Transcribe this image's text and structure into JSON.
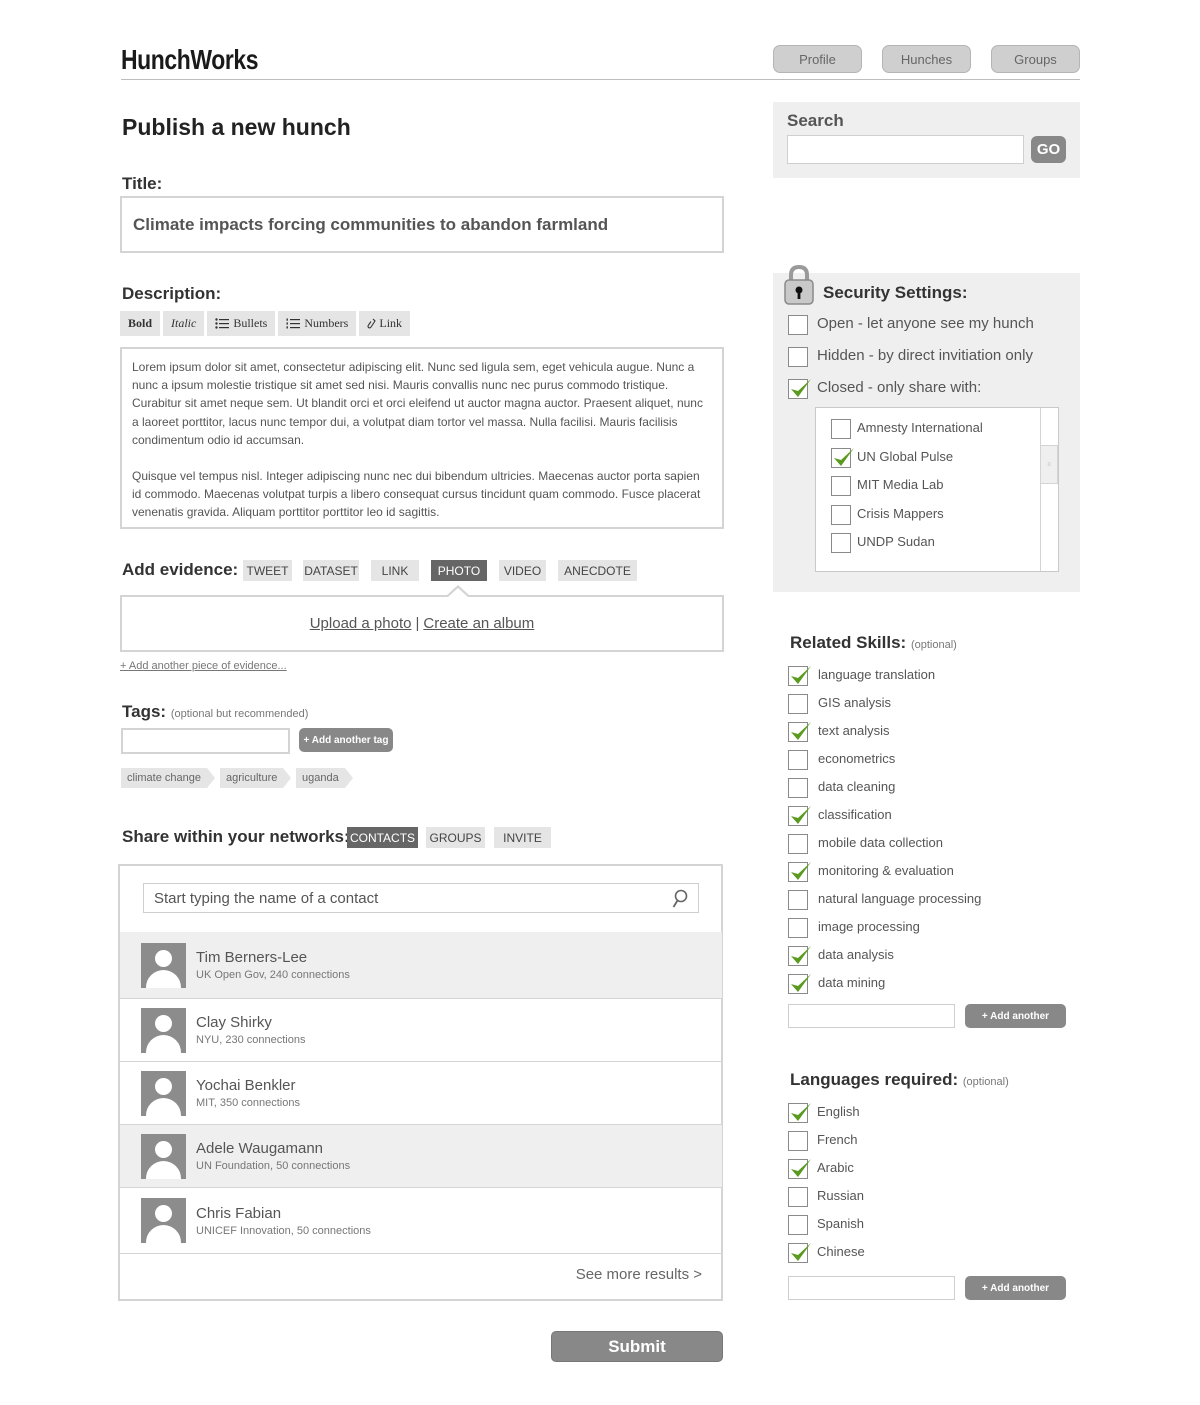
{
  "app": {
    "logo": "HunchWorks"
  },
  "nav": {
    "profile": "Profile",
    "hunches": "Hunches",
    "groups": "Groups"
  },
  "page_title": "Publish a new hunch",
  "title_section": {
    "label": "Title:",
    "value": "Climate impacts forcing communities to abandon farmland"
  },
  "description": {
    "label": "Description:",
    "toolbar": {
      "bold": "Bold",
      "italic": "Italic",
      "bullets": "Bullets",
      "numbers": "Numbers",
      "link": "Link"
    },
    "paragraph1": "Lorem ipsum dolor sit amet, consectetur adipiscing elit. Nunc sed ligula sem, eget vehicula augue. Nunc a nunc a ipsum molestie tristique sit amet sed nisi. Mauris convallis nunc nec purus commodo tristique. Curabitur sit amet neque sem. Ut blandit orci et orci eleifend ut auctor magna auctor. Praesent aliquet, nunc a laoreet porttitor, lacus nunc tempor dui, a volutpat diam tortor vel massa. Nulla facilisi. Mauris facilisis condimentum odio id accumsan.",
    "paragraph2": "Quisque vel tempus nisl. Integer adipiscing nunc nec dui bibendum ultricies. Maecenas auctor porta sapien id commodo. Maecenas volutpat turpis a libero consequat cursus tincidunt quam commodo. Fusce placerat venenatis gravida. Aliquam porttitor porttitor leo id sagittis."
  },
  "evidence": {
    "label": "Add evidence:",
    "tabs": [
      "TWEET",
      "DATASET",
      "LINK",
      "PHOTO",
      "VIDEO",
      "ANECDOTE"
    ],
    "active_tab": "PHOTO",
    "upload_link": "Upload a photo",
    "separator": "|",
    "album_link": "Create an album",
    "add_another": "+ Add another piece of evidence..."
  },
  "tags": {
    "label": "Tags:",
    "optional": "(optional but recommended)",
    "input_value": "",
    "add_button": "+ Add another tag",
    "items": [
      "climate change",
      "agriculture",
      "uganda"
    ]
  },
  "share": {
    "label": "Share within your networks:",
    "tabs": [
      "CONTACTS",
      "GROUPS",
      "INVITE"
    ],
    "active_tab": "CONTACTS",
    "search_placeholder": "Start typing the name of a contact",
    "contacts": [
      {
        "name": "Tim Berners-Lee",
        "detail": "UK Open Gov, 240 connections"
      },
      {
        "name": "Clay Shirky",
        "detail": "NYU, 230 connections"
      },
      {
        "name": "Yochai Benkler",
        "detail": "MIT, 350 connections"
      },
      {
        "name": "Adele Waugamann",
        "detail": "UN Foundation, 50 connections"
      },
      {
        "name": "Chris Fabian",
        "detail": "UNICEF Innovation, 50 connections"
      }
    ],
    "see_more": "See more results >"
  },
  "submit": "Submit",
  "search": {
    "label": "Search",
    "value": "",
    "go": "GO"
  },
  "security": {
    "title": "Security Settings:",
    "options": [
      {
        "label": "Open - let anyone see my hunch",
        "checked": false
      },
      {
        "label": "Hidden - by direct invitiation only",
        "checked": false
      },
      {
        "label": "Closed - only share with:",
        "checked": true
      }
    ],
    "orgs": [
      {
        "label": "Amnesty International",
        "checked": false
      },
      {
        "label": "UN Global Pulse",
        "checked": true
      },
      {
        "label": "MIT Media Lab",
        "checked": false
      },
      {
        "label": "Crisis Mappers",
        "checked": false
      },
      {
        "label": "UNDP Sudan",
        "checked": false
      }
    ]
  },
  "skills": {
    "title": "Related Skills:",
    "optional": "(optional)",
    "items": [
      {
        "label": "language translation",
        "checked": true
      },
      {
        "label": "GIS analysis",
        "checked": false
      },
      {
        "label": "text analysis",
        "checked": true
      },
      {
        "label": "econometrics",
        "checked": false
      },
      {
        "label": "data cleaning",
        "checked": false
      },
      {
        "label": "classification",
        "checked": true
      },
      {
        "label": "mobile data collection",
        "checked": false
      },
      {
        "label": "monitoring & evaluation",
        "checked": true
      },
      {
        "label": "natural language processing",
        "checked": false
      },
      {
        "label": "image processing",
        "checked": false
      },
      {
        "label": "data analysis",
        "checked": true
      },
      {
        "label": "data mining",
        "checked": true
      }
    ],
    "add_button": "+ Add another"
  },
  "languages": {
    "title": "Languages required:",
    "optional": "(optional)",
    "items": [
      {
        "label": "English",
        "checked": true
      },
      {
        "label": "French",
        "checked": false
      },
      {
        "label": "Arabic",
        "checked": true
      },
      {
        "label": "Russian",
        "checked": false
      },
      {
        "label": "Spanish",
        "checked": false
      },
      {
        "label": "Chinese",
        "checked": true
      }
    ],
    "add_button": "+ Add another"
  },
  "colors": {
    "check": "#5a9a1e",
    "panel": "#efefef",
    "active_tab": "#666666",
    "button": "#888888"
  }
}
